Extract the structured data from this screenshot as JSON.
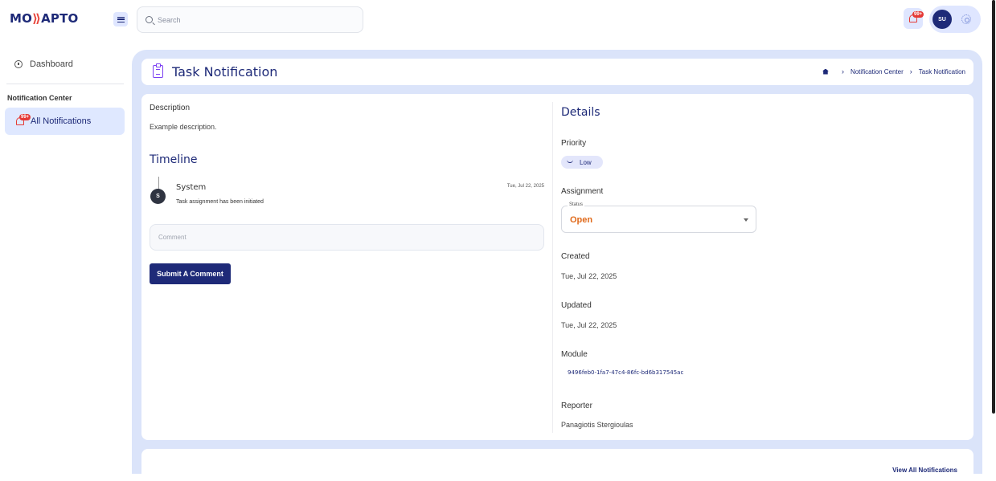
{
  "brand": {
    "logo_left": "MO",
    "logo_mark": "⟫",
    "logo_right": "APTO"
  },
  "search": {
    "placeholder": "Search"
  },
  "topbar": {
    "notif_badge": "99+",
    "avatar_initials": "SU"
  },
  "sidebar": {
    "dashboard_label": "Dashboard",
    "section_title": "Notification Center",
    "active_label": "All Notifications",
    "active_badge": "99+"
  },
  "header": {
    "title": "Task Notification",
    "breadcrumbs": [
      "Notification Center",
      "Task Notification"
    ]
  },
  "left": {
    "description_label": "Description",
    "description_text": "Example description.",
    "timeline_title": "Timeline",
    "timeline": [
      {
        "initial": "S",
        "user": "System",
        "date": "Tue, Jul 22, 2025",
        "message": "Task assignment has been initiated"
      }
    ],
    "comment_placeholder": "Comment",
    "submit_label": "Submit A Comment"
  },
  "details": {
    "title": "Details",
    "priority_label": "Priority",
    "priority_value": "Low",
    "assignment_label": "Assignment",
    "status_legend": "Status",
    "status_value": "Open",
    "created_label": "Created",
    "created_value": "Tue, Jul 22, 2025",
    "updated_label": "Updated",
    "updated_value": "Tue, Jul 22, 2025",
    "module_label": "Module",
    "module_value": "9496feb0-1fa7-47c4-86fc-bd6b317545ac",
    "reporter_label": "Reporter",
    "reporter_value": "Panagiotis Stergioulas"
  },
  "footer": {
    "view_all_label": "View All Notifications"
  },
  "colors": {
    "primary": "#1e2a78",
    "accent": "#7b3ff2",
    "status_open": "#e06a1b",
    "badge": "#e53935",
    "content_bg": "#dbe4fa"
  }
}
